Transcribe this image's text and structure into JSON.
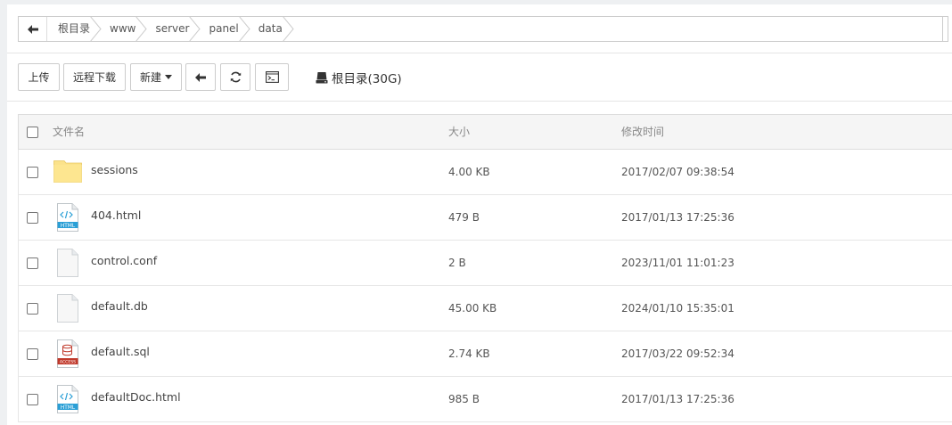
{
  "breadcrumb": {
    "items": [
      "根目录",
      "www",
      "server",
      "panel",
      "data"
    ]
  },
  "toolbar": {
    "upload_label": "上传",
    "remote_download_label": "远程下载",
    "new_label": "新建",
    "disk_label": "根目录(30G)"
  },
  "table": {
    "headers": {
      "name": "文件名",
      "size": "大小",
      "mtime": "修改时间"
    },
    "rows": [
      {
        "name": "sessions",
        "size": "4.00 KB",
        "mtime": "2017/02/07 09:38:54",
        "icon": "folder-icon"
      },
      {
        "name": "404.html",
        "size": "479 B",
        "mtime": "2017/01/13 17:25:36",
        "icon": "html-file-icon"
      },
      {
        "name": "control.conf",
        "size": "2 B",
        "mtime": "2023/11/01 11:01:23",
        "icon": "blank-file-icon"
      },
      {
        "name": "default.db",
        "size": "45.00 KB",
        "mtime": "2024/01/10 15:35:01",
        "icon": "blank-file-icon"
      },
      {
        "name": "default.sql",
        "size": "2.74 KB",
        "mtime": "2017/03/22 09:52:34",
        "icon": "database-file-icon"
      },
      {
        "name": "defaultDoc.html",
        "size": "985 B",
        "mtime": "2017/01/13 17:25:36",
        "icon": "html-file-icon"
      }
    ]
  },
  "icon_labels": {
    "html": "HTML",
    "access": "ACCESS"
  },
  "colors": {
    "folder": "#fce38a",
    "html_blue": "#2a9fd6",
    "db_red": "#c0392b"
  }
}
